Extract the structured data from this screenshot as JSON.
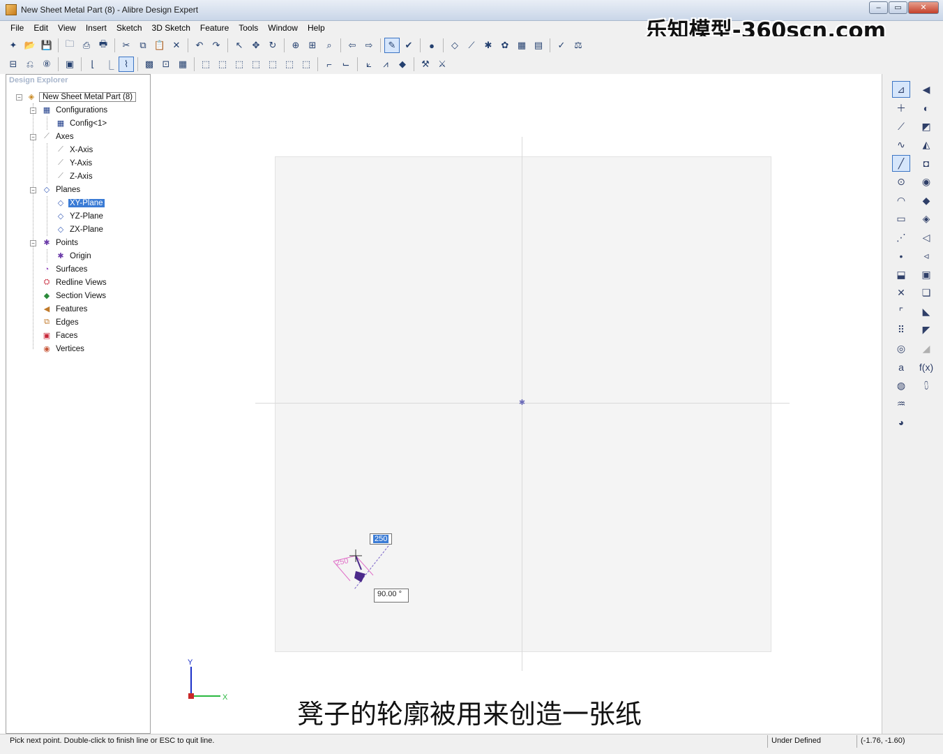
{
  "window": {
    "title": "New Sheet Metal Part (8) - Alibre Design Expert",
    "minimize": "‒",
    "maximize": "▭",
    "close": "✕"
  },
  "watermark": "乐知模型-360scn.com",
  "menu": [
    "File",
    "Edit",
    "View",
    "Insert",
    "Sketch",
    "3D Sketch",
    "Feature",
    "Tools",
    "Window",
    "Help"
  ],
  "explorer": {
    "header": "Design Explorer",
    "tree": [
      {
        "label": "New Sheet Metal Part (8)",
        "icon": "part-icon"
      },
      {
        "label": "Configurations",
        "icon": "configurations-icon"
      },
      {
        "label": "Config<1>",
        "icon": "config-icon"
      },
      {
        "label": "Axes",
        "icon": "axes-icon"
      },
      {
        "label": "X-Axis",
        "icon": "axis-icon"
      },
      {
        "label": "Y-Axis",
        "icon": "axis-icon"
      },
      {
        "label": "Z-Axis",
        "icon": "axis-icon"
      },
      {
        "label": "Planes",
        "icon": "planes-icon"
      },
      {
        "label": "XY-Plane",
        "icon": "plane-icon"
      },
      {
        "label": "YZ-Plane",
        "icon": "plane-icon"
      },
      {
        "label": "ZX-Plane",
        "icon": "plane-icon"
      },
      {
        "label": "Points",
        "icon": "points-icon"
      },
      {
        "label": "Origin",
        "icon": "origin-icon"
      },
      {
        "label": "Surfaces",
        "icon": "surfaces-icon"
      },
      {
        "label": "Redline Views",
        "icon": "redline-views-icon"
      },
      {
        "label": "Section Views",
        "icon": "section-views-icon"
      },
      {
        "label": "Features",
        "icon": "features-icon"
      },
      {
        "label": "Edges",
        "icon": "edges-icon"
      },
      {
        "label": "Faces",
        "icon": "faces-icon"
      },
      {
        "label": "Vertices",
        "icon": "vertices-icon"
      }
    ]
  },
  "canvas": {
    "dim_length": "250",
    "dim_length_ghost": "250",
    "dim_angle": "90.00 °",
    "triad_y": "Y",
    "triad_x": "X"
  },
  "subtitle": "凳子的轮廓被用来创造一张纸",
  "status": {
    "message": "Pick next point.  Double-click to finish line or ESC to quit line.",
    "state": "Under Defined",
    "coordinates": "(-1.76, -1.60)"
  },
  "right_toolbar": {
    "fx_label": "f(x)",
    "text_label": "a"
  },
  "colors": {
    "selection": "#3a7bd5",
    "sketch_plane": "#f4f4f4",
    "sketch_line": "#4b2a8a",
    "constraint_pink": "#e070c8"
  }
}
